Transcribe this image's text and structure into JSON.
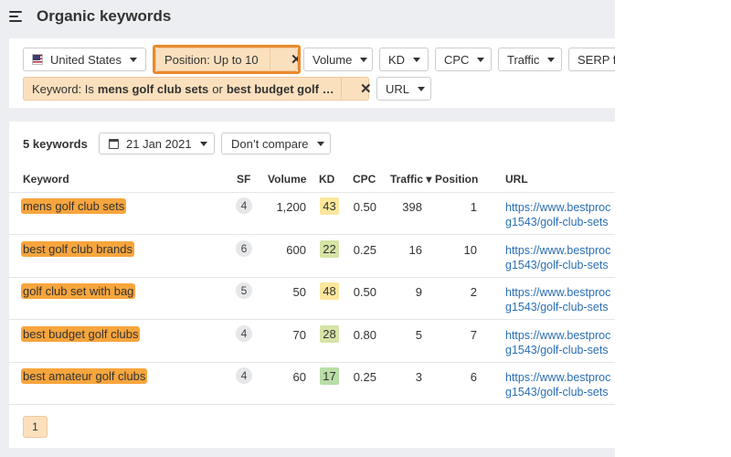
{
  "header": {
    "title": "Organic keywords"
  },
  "filters": {
    "country": "United States",
    "position": "Position: Up to 10",
    "volume": "Volume",
    "kd": "KD",
    "cpc": "CPC",
    "traffic": "Traffic",
    "serp": "SERP f",
    "keyword_prefix": "Keyword: Is",
    "keyword_a": "mens golf club sets",
    "keyword_or": "or",
    "keyword_b": "best budget golf …",
    "url": "URL"
  },
  "toolbar": {
    "summary": "5 keywords",
    "date": "21 Jan 2021",
    "compare": "Don’t compare"
  },
  "columns": {
    "keyword": "Keyword",
    "sf": "SF",
    "volume": "Volume",
    "kd": "KD",
    "cpc": "CPC",
    "traffic": "Traffic ▾",
    "position": "Position",
    "url": "URL"
  },
  "rows": [
    {
      "keyword": "mens golf club sets",
      "sf": "4",
      "volume": "1,200",
      "kd": "43",
      "kd_color": "#fbe79c",
      "cpc": "0.50",
      "traffic": "398",
      "position": "1",
      "url1": "https://www.bestproc",
      "url2": "g1543/golf-club-sets"
    },
    {
      "keyword": "best golf club brands",
      "sf": "6",
      "volume": "600",
      "kd": "22",
      "kd_color": "#d6e4a6",
      "cpc": "0.25",
      "traffic": "16",
      "position": "10",
      "url1": "https://www.bestproc",
      "url2": "g1543/golf-club-sets"
    },
    {
      "keyword": "golf club set with bag",
      "sf": "5",
      "volume": "50",
      "kd": "48",
      "kd_color": "#fbe79c",
      "cpc": "0.50",
      "traffic": "9",
      "position": "2",
      "url1": "https://www.bestproc",
      "url2": "g1543/golf-club-sets"
    },
    {
      "keyword": "best budget golf clubs",
      "sf": "4",
      "volume": "70",
      "kd": "28",
      "kd_color": "#d6e4a6",
      "cpc": "0.80",
      "traffic": "5",
      "position": "7",
      "url1": "https://www.bestproc",
      "url2": "g1543/golf-club-sets"
    },
    {
      "keyword": "best amateur golf clubs",
      "sf": "4",
      "volume": "60",
      "kd": "17",
      "kd_color": "#b9dea6",
      "cpc": "0.25",
      "traffic": "3",
      "position": "6",
      "url1": "https://www.bestproc",
      "url2": "g1543/golf-club-sets"
    }
  ],
  "pagination": {
    "current": "1"
  },
  "colors": {
    "keyword_highlight": "#f7a53d",
    "active_chip": "#fbe0be",
    "focus_ring": "#e9892c",
    "link": "#2b6fb3"
  }
}
